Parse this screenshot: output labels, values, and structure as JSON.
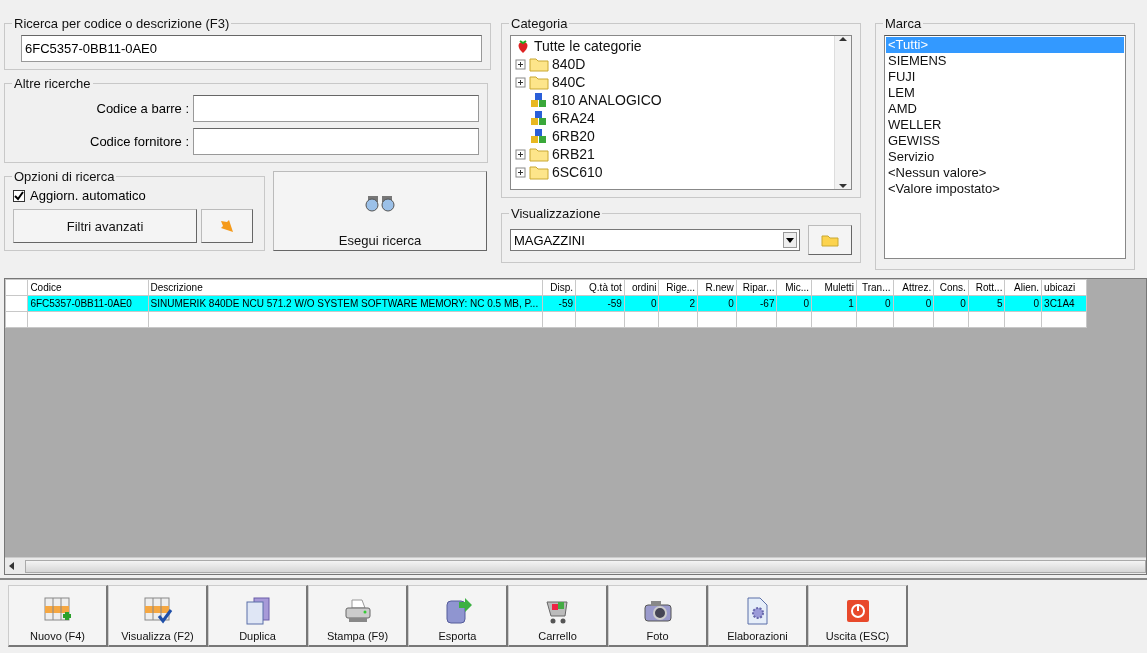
{
  "search": {
    "title": "Ricerca per codice o descrizione (F3)",
    "value": "6FC5357-0BB11-0AE0"
  },
  "other": {
    "title": "Altre ricerche",
    "fields": [
      {
        "label": "Codice a barre :"
      },
      {
        "label": "Codice fornitore :"
      }
    ]
  },
  "options": {
    "title": "Opzioni di ricerca",
    "auto_update": {
      "label": "Aggiorn. automatico",
      "checked": true
    },
    "filters_button": "Filtri avanzati"
  },
  "run_button": "Esegui ricerca",
  "category": {
    "title": "Categoria",
    "items": [
      {
        "kind": "root",
        "label": "Tutte le categorie"
      },
      {
        "kind": "folder",
        "label": "840D"
      },
      {
        "kind": "folder",
        "label": "840C"
      },
      {
        "kind": "module",
        "label": "810 ANALOGICO"
      },
      {
        "kind": "module",
        "label": "6RA24"
      },
      {
        "kind": "module",
        "label": "6RB20"
      },
      {
        "kind": "folder",
        "label": "6RB21"
      },
      {
        "kind": "folder",
        "label": "6SC610"
      }
    ]
  },
  "view": {
    "title": "Visualizzazione",
    "value": "MAGAZZINI"
  },
  "brand": {
    "title": "Marca",
    "items": [
      {
        "label": "<Tutti>",
        "selected": true
      },
      {
        "label": "SIEMENS",
        "selected": false
      },
      {
        "label": "FUJI",
        "selected": false
      },
      {
        "label": "LEM",
        "selected": false
      },
      {
        "label": "AMD",
        "selected": false
      },
      {
        "label": "WELLER",
        "selected": false
      },
      {
        "label": "GEWISS",
        "selected": false
      },
      {
        "label": "Servizio",
        "selected": false
      },
      {
        "label": "<Nessun valore>",
        "selected": false
      },
      {
        "label": "<Valore impostato>",
        "selected": false
      }
    ]
  },
  "table": {
    "columns": [
      {
        "label": "Codice"
      },
      {
        "label": "Descrizione"
      },
      {
        "label": "Disp."
      },
      {
        "label": "Q.tà tot"
      },
      {
        "label": "ordini"
      },
      {
        "label": "Rige..."
      },
      {
        "label": "R.new"
      },
      {
        "label": "Ripar..."
      },
      {
        "label": "Mic..."
      },
      {
        "label": "Muletti"
      },
      {
        "label": "Tran..."
      },
      {
        "label": "Attrez."
      },
      {
        "label": "Cons."
      },
      {
        "label": "Rott..."
      },
      {
        "label": "Alien."
      },
      {
        "label": "ubicazi"
      }
    ],
    "rows": [
      {
        "selected": true,
        "cells": [
          "6FC5357-0BB11-0AE0",
          "SINUMERIK 840DE NCU 571.2 W/O SYSTEM SOFTWARE MEMORY: NC 0.5 MB, P...",
          "-59",
          "-59",
          "0",
          "2",
          "0",
          "-67",
          "0",
          "1",
          "0",
          "0",
          "0",
          "5",
          "0",
          "3C1A4"
        ]
      }
    ]
  },
  "buttons": [
    {
      "kind": "new",
      "label": "Nuovo (F4)"
    },
    {
      "kind": "view",
      "label": "Visualizza (F2)"
    },
    {
      "kind": "duplicate",
      "label": "Duplica"
    },
    {
      "kind": "print",
      "label": "Stampa (F9)"
    },
    {
      "kind": "export",
      "label": "Esporta"
    },
    {
      "kind": "cart",
      "label": "Carrello"
    },
    {
      "kind": "photo",
      "label": "Foto"
    },
    {
      "kind": "process",
      "label": "Elaborazioni"
    },
    {
      "kind": "exit",
      "label": "Uscita (ESC)"
    }
  ]
}
